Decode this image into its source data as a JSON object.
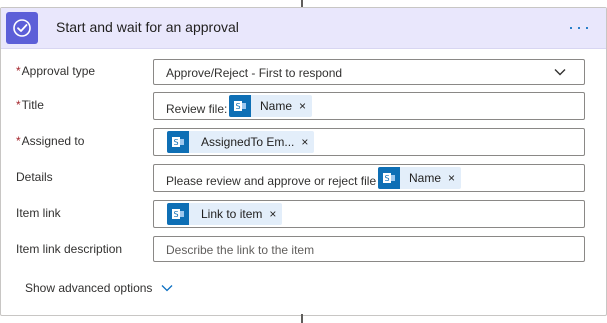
{
  "action": {
    "title": "Start and wait for an approval",
    "icon": "approval-check-icon",
    "more_label": "···",
    "accent_color": "#5c5fd8",
    "header_bg": "#e9e7fc"
  },
  "fields": {
    "approval_type": {
      "required_mark": "*",
      "label": "Approval type",
      "value": "Approve/Reject - First to respond"
    },
    "title": {
      "required_mark": "*",
      "label": "Title",
      "prefix_text": "Review file:",
      "token": "Name",
      "token_remove": "×"
    },
    "assigned_to": {
      "required_mark": "*",
      "label": "Assigned to",
      "token": "AssignedTo Em...",
      "token_remove": "×"
    },
    "details": {
      "label": "Details",
      "prefix_text": "Please review and approve or reject file",
      "token": "Name",
      "token_remove": "×"
    },
    "item_link": {
      "label": "Item link",
      "token": "Link to item",
      "token_remove": "×"
    },
    "item_link_description": {
      "label": "Item link description",
      "placeholder": "Describe the link to the item"
    }
  },
  "footer": {
    "advanced_label": "Show advanced options"
  },
  "colors": {
    "token_bg": "#e3eefa",
    "token_icon_bg": "#0e6fb5",
    "link_blue": "#0b6fc2",
    "required_red": "#a4262c"
  }
}
